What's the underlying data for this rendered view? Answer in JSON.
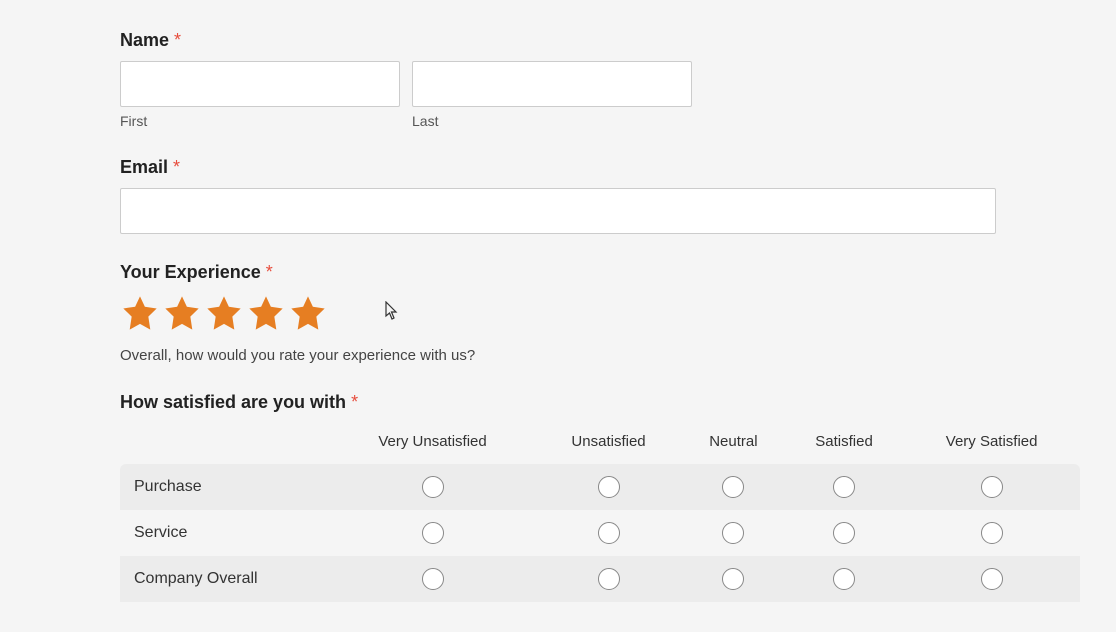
{
  "name": {
    "label": "Name",
    "first_sublabel": "First",
    "last_sublabel": "Last",
    "first_value": "",
    "last_value": ""
  },
  "email": {
    "label": "Email",
    "value": ""
  },
  "experience": {
    "label": "Your Experience",
    "star_count": 5,
    "description": "Overall, how would you rate your experience with us?"
  },
  "satisfaction": {
    "label": "How satisfied are you with",
    "columns": [
      "Very Unsatisfied",
      "Unsatisfied",
      "Neutral",
      "Satisfied",
      "Very Satisfied"
    ],
    "rows": [
      "Purchase",
      "Service",
      "Company Overall"
    ]
  },
  "required_mark": "*"
}
